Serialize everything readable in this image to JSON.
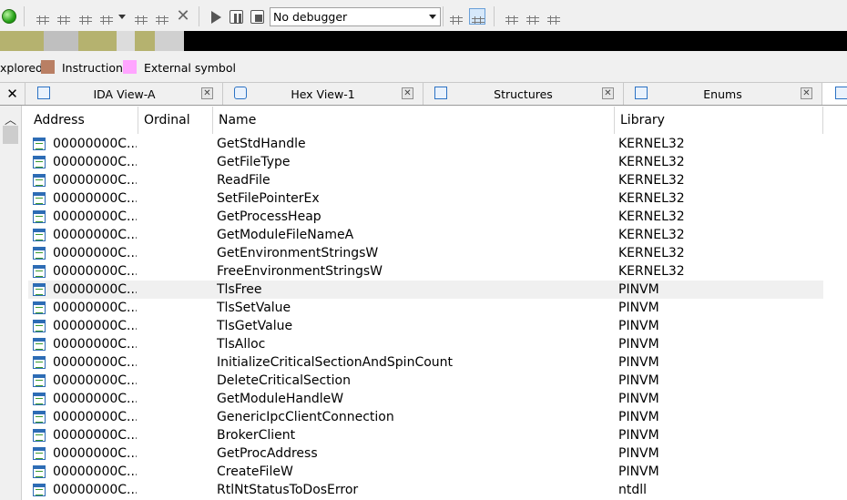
{
  "toolbar": {
    "debugger": "No debugger",
    "icons": [
      "run-status-icon",
      "code-segment-icon",
      "data-segment-icon",
      "create-structure-icon",
      "cursor-tools-icon",
      "dropdown-arrow-icon",
      "patch-icon",
      "edit-function-icon",
      "close-x-icon",
      "play-icon",
      "pause-icon",
      "stop-icon",
      "attach-process-icon",
      "run-to-cursor-icon",
      "breakpoints-icon",
      "add-watch-icon",
      "delete-watch-icon"
    ]
  },
  "navband": {
    "colors": [
      "#b5b26f",
      "#bfbfbf",
      "#b5b26f",
      "#dcdcdc",
      "#b5b26f",
      "#000000"
    ]
  },
  "legend": {
    "items": [
      {
        "label": "xplored",
        "color": ""
      },
      {
        "label": "Instruction",
        "color": "#b97f64"
      },
      {
        "label": "External symbol",
        "color": "#ffa5ff"
      }
    ]
  },
  "tabs": [
    {
      "label": "IDA View-A",
      "icon": "disassembly-view-icon"
    },
    {
      "label": "Hex View-1",
      "icon": "hex-view-icon"
    },
    {
      "label": "Structures",
      "icon": "structures-icon"
    },
    {
      "label": "Enums",
      "icon": "enums-icon"
    }
  ],
  "table": {
    "columns": [
      "Address",
      "Ordinal",
      "Name",
      "Library"
    ],
    "rows": [
      {
        "address": "00000000C...",
        "ordinal": "",
        "name": "GetStdHandle",
        "library": "KERNEL32"
      },
      {
        "address": "00000000C...",
        "ordinal": "",
        "name": "GetFileType",
        "library": "KERNEL32"
      },
      {
        "address": "00000000C...",
        "ordinal": "",
        "name": "ReadFile",
        "library": "KERNEL32"
      },
      {
        "address": "00000000C...",
        "ordinal": "",
        "name": "SetFilePointerEx",
        "library": "KERNEL32"
      },
      {
        "address": "00000000C...",
        "ordinal": "",
        "name": "GetProcessHeap",
        "library": "KERNEL32"
      },
      {
        "address": "00000000C...",
        "ordinal": "",
        "name": "GetModuleFileNameA",
        "library": "KERNEL32"
      },
      {
        "address": "00000000C...",
        "ordinal": "",
        "name": "GetEnvironmentStringsW",
        "library": "KERNEL32"
      },
      {
        "address": "00000000C...",
        "ordinal": "",
        "name": "FreeEnvironmentStringsW",
        "library": "KERNEL32"
      },
      {
        "address": "00000000C...",
        "ordinal": "",
        "name": "TlsFree",
        "library": "PINVM",
        "selected": true
      },
      {
        "address": "00000000C...",
        "ordinal": "",
        "name": "TlsSetValue",
        "library": "PINVM"
      },
      {
        "address": "00000000C...",
        "ordinal": "",
        "name": "TlsGetValue",
        "library": "PINVM"
      },
      {
        "address": "00000000C...",
        "ordinal": "",
        "name": "TlsAlloc",
        "library": "PINVM"
      },
      {
        "address": "00000000C...",
        "ordinal": "",
        "name": "InitializeCriticalSectionAndSpinCount",
        "library": "PINVM"
      },
      {
        "address": "00000000C...",
        "ordinal": "",
        "name": "DeleteCriticalSection",
        "library": "PINVM"
      },
      {
        "address": "00000000C...",
        "ordinal": "",
        "name": "GetModuleHandleW",
        "library": "PINVM"
      },
      {
        "address": "00000000C...",
        "ordinal": "",
        "name": "GenericIpcClientConnection",
        "library": "PINVM"
      },
      {
        "address": "00000000C...",
        "ordinal": "",
        "name": "BrokerClient",
        "library": "PINVM"
      },
      {
        "address": "00000000C...",
        "ordinal": "",
        "name": "GetProcAddress",
        "library": "PINVM"
      },
      {
        "address": "00000000C...",
        "ordinal": "",
        "name": "CreateFileW",
        "library": "PINVM"
      },
      {
        "address": "00000000C...",
        "ordinal": "",
        "name": "RtlNtStatusToDosError",
        "library": "ntdll"
      }
    ]
  }
}
